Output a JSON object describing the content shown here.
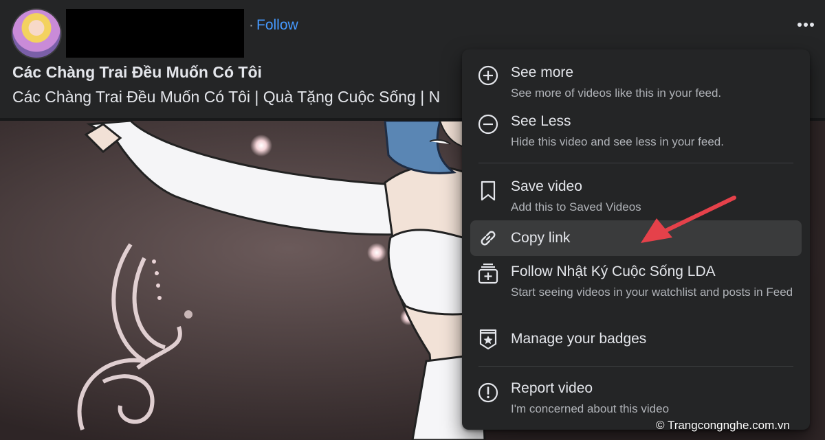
{
  "post": {
    "follow_label": "Follow",
    "follow_dot": "·",
    "title": "Các Chàng Trai Đều Muốn Có Tôi",
    "subtitle": "Các Chàng Trai Đều Muốn Có Tôi | Quà Tặng Cuộc Sống | N"
  },
  "menu": {
    "items": [
      {
        "label": "See more",
        "desc": "See more of videos like this in your feed.",
        "icon": "plus-circle-icon"
      },
      {
        "label": "See Less",
        "desc": "Hide this video and see less in your feed.",
        "icon": "minus-circle-icon"
      },
      {
        "label": "Save video",
        "desc": "Add this to Saved Videos",
        "icon": "bookmark-icon"
      },
      {
        "label": "Copy link",
        "desc": "",
        "icon": "link-icon"
      },
      {
        "label": "Follow Nhật Ký Cuộc Sống LDA",
        "desc": "Start seeing videos in your watchlist and posts in Feed",
        "icon": "watchlist-add-icon"
      },
      {
        "label": "Manage your badges",
        "desc": "",
        "icon": "badge-icon"
      },
      {
        "label": "Report video",
        "desc": "I'm concerned about this video",
        "icon": "report-icon"
      }
    ]
  },
  "watermark": "© Trangcongnghe.com.vn",
  "colors": {
    "accent": "#4599ff",
    "menu_bg": "#242526",
    "highlight": "#3a3b3c",
    "arrow": "#e5414a"
  }
}
